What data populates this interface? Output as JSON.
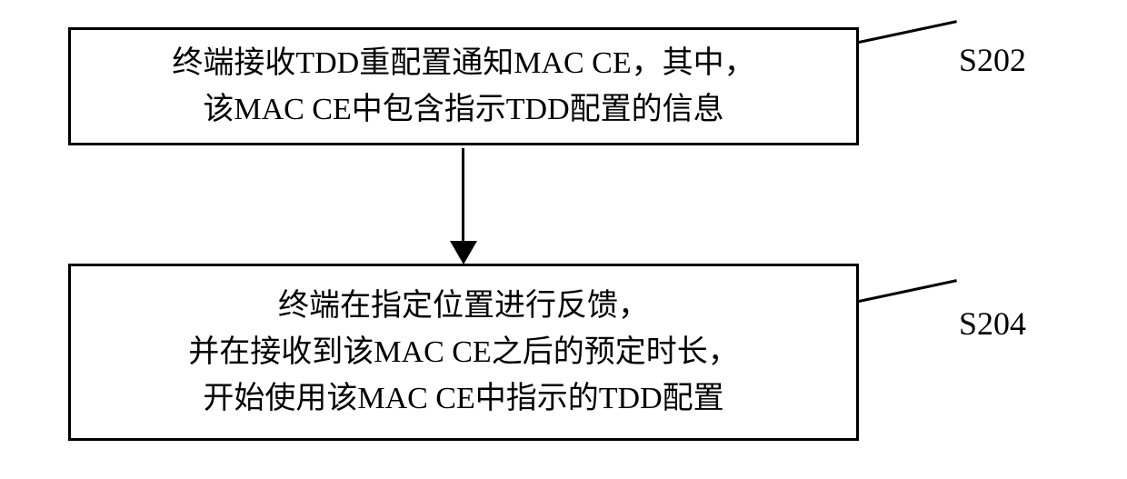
{
  "flow": {
    "steps": [
      {
        "id": "S202",
        "text": "终端接收TDD重配置通知MAC CE，其中，\n该MAC CE中包含指示TDD配置的信息"
      },
      {
        "id": "S204",
        "text": "终端在指定位置进行反馈，\n并在接收到该MAC CE之后的预定时长，\n开始使用该MAC CE中指示的TDD配置"
      }
    ]
  }
}
